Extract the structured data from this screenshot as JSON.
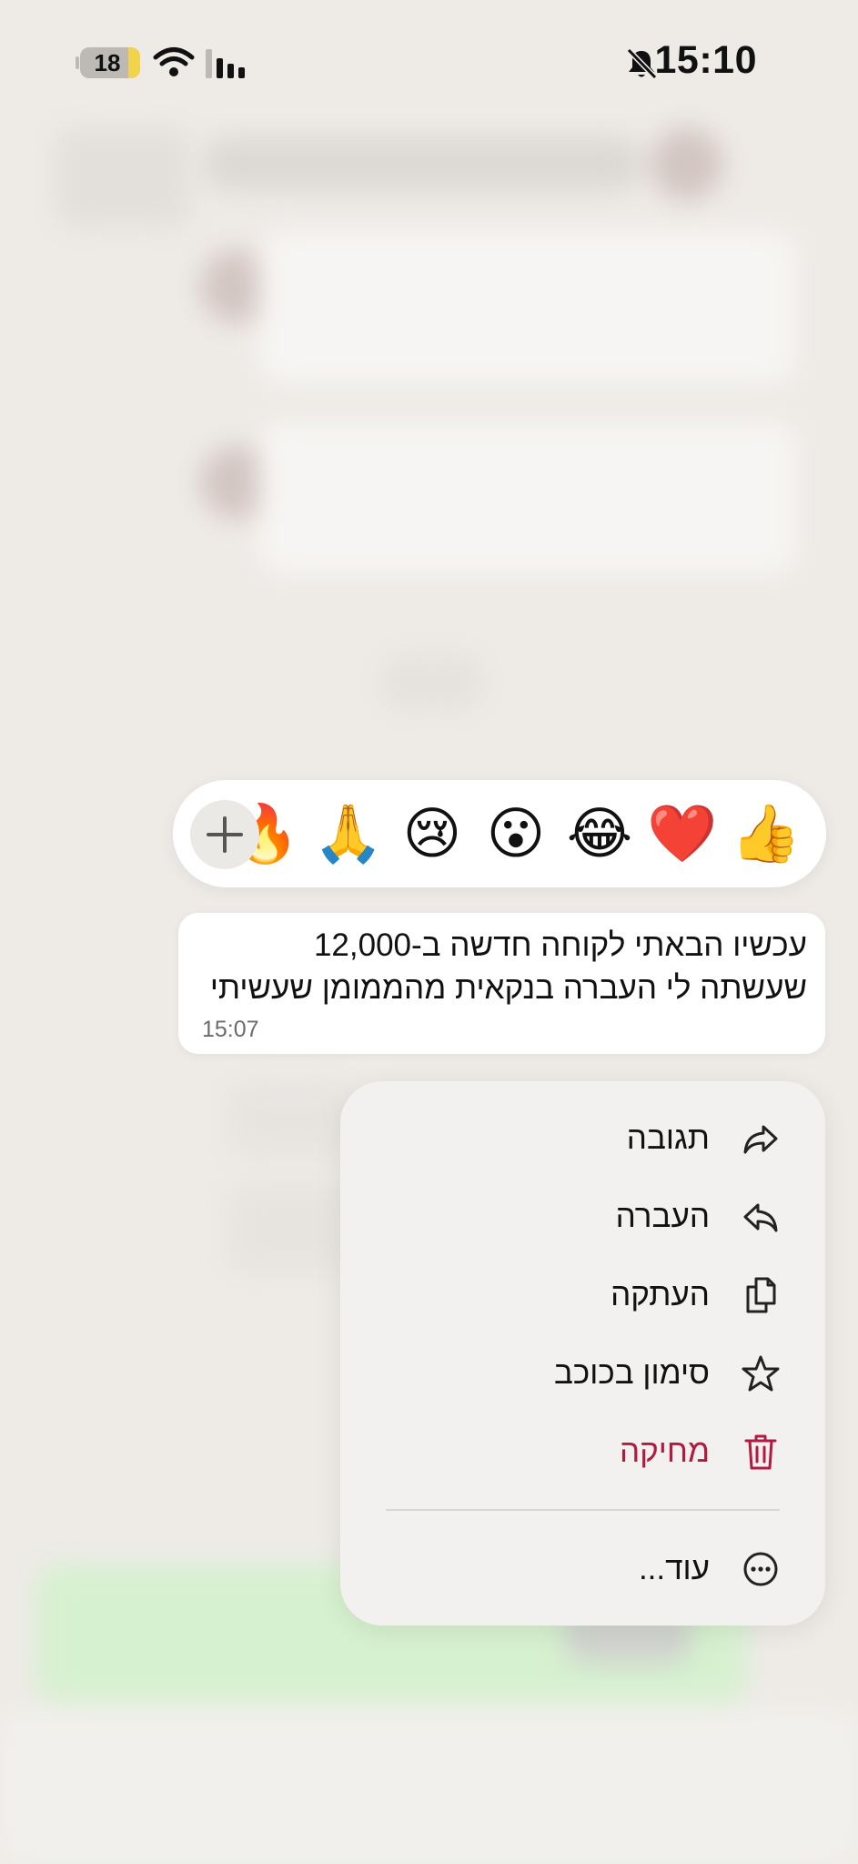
{
  "status_bar": {
    "time": "15:10",
    "battery_level": "18",
    "icons": [
      "mute-bell-icon",
      "wifi-icon",
      "signal-icon",
      "battery-icon"
    ]
  },
  "reactions": {
    "emojis": [
      "👍",
      "❤️",
      "😂",
      "😮",
      "😢",
      "🙏",
      "🔥"
    ],
    "add_icon": "plus-icon"
  },
  "message": {
    "line1": "עכשיו הבאתי לקוחה חדשה ב-12,000",
    "line2": "שעשתה לי העברה בנקאית מהממומן שעשיתי",
    "time": "15:07"
  },
  "menu": {
    "items": [
      {
        "label": "תגובה",
        "icon": "reply-arrow-icon"
      },
      {
        "label": "העברה",
        "icon": "forward-arrow-icon"
      },
      {
        "label": "העתקה",
        "icon": "copy-icon"
      },
      {
        "label": "סימון בכוכב",
        "icon": "star-icon"
      },
      {
        "label": "מחיקה",
        "icon": "trash-icon",
        "color": "#b21a3e"
      },
      {
        "label": "עוד...",
        "icon": "more-icon"
      }
    ]
  },
  "colors": {
    "background": "#eeebe7",
    "bubble": "#ffffff",
    "menu": "#f2f1f0",
    "danger": "#b21a3e",
    "battery": "#f3d24c"
  }
}
